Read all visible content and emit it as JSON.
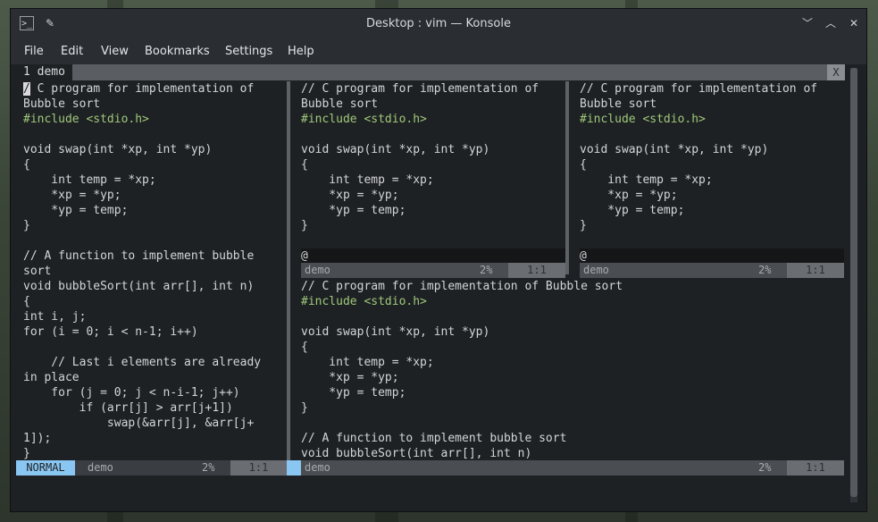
{
  "window": {
    "title": "Desktop : vim — Konsole",
    "term_icon": "terminal-icon",
    "pin_icon": "pin-icon",
    "minimize_glyph": "﹀",
    "maximize_glyph": "︿",
    "close_glyph": "✕"
  },
  "menu": [
    "File",
    "Edit",
    "View",
    "Bookmarks",
    "Settings",
    "Help"
  ],
  "tabline": {
    "active_tab": "1  demo",
    "close_label": "X"
  },
  "left_pane": {
    "first_char": "/",
    "lines": [
      "/ C program for implementation of",
      "Bubble sort",
      "#include <stdio.h>",
      "",
      "void swap(int *xp, int *yp)",
      "{",
      "    int temp = *xp;",
      "    *xp = *yp;",
      "    *yp = temp;",
      "}",
      "",
      "// A function to implement bubble",
      "sort",
      "void bubbleSort(int arr[], int n)",
      "{",
      "int i, j;",
      "for (i = 0; i < n-1; i++)",
      "",
      "    // Last i elements are already",
      "in place",
      "    for (j = 0; j < n-i-1; j++)",
      "        if (arr[j] > arr[j+1])",
      "            swap(&arr[j], &arr[j+",
      "1]);",
      "}"
    ],
    "status": {
      "mode": "NORMAL",
      "file": "demo",
      "percent": "2%",
      "position": "1:1"
    }
  },
  "mid_pane": {
    "lines": [
      "// C program for implementation of",
      "Bubble sort",
      "#include <stdio.h>",
      "",
      "void swap(int *xp, int *yp)",
      "{",
      "    int temp = *xp;",
      "    *xp = *yp;",
      "    *yp = temp;",
      "}",
      "",
      "@"
    ],
    "status": {
      "file": "demo",
      "percent": "2%",
      "position": "1:1"
    }
  },
  "right_pane": {
    "lines": [
      "// C program for implementation of",
      "Bubble sort",
      "#include <stdio.h>",
      "",
      "void swap(int *xp, int *yp)",
      "{",
      "    int temp = *xp;",
      "    *xp = *yp;",
      "    *yp = temp;",
      "}",
      "",
      "@"
    ],
    "status": {
      "file": "demo",
      "percent": "2%",
      "position": "1:1"
    }
  },
  "bottom_pane": {
    "lines": [
      "// C program for implementation of Bubble sort",
      "#include <stdio.h>",
      "",
      "void swap(int *xp, int *yp)",
      "{",
      "    int temp = *xp;",
      "    *xp = *yp;",
      "    *yp = temp;",
      "}",
      "",
      "// A function to implement bubble sort",
      "void bubbleSort(int arr[], int n)"
    ],
    "status": {
      "file": "demo",
      "percent": "2%",
      "position": "1:1"
    }
  },
  "colors": {
    "mode_bg": "#8ac6f2",
    "include_fg": "#9fc87a",
    "terminal_bg": "#1e2124",
    "status_bg": "#4a4d51"
  }
}
